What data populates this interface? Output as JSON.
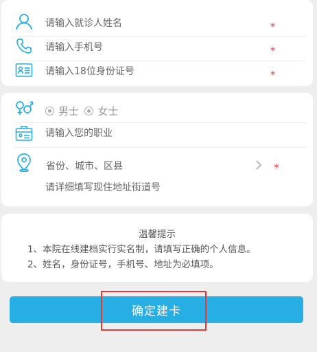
{
  "patient": {
    "name_placeholder": "请输入就诊人姓名",
    "phone_placeholder": "请输入手机号",
    "idcard_placeholder": "请输入18位身份证号",
    "required_mark": "*"
  },
  "profile": {
    "gender_options": [
      "男士",
      "女士"
    ],
    "occupation_placeholder": "请输入您的职业",
    "region_placeholder": "省份、城市、区县",
    "address_placeholder": "请详细填写现住地址街道号",
    "required_mark": "*"
  },
  "tips": {
    "title": "温馨提示",
    "line1": "1、本院在线建档实行实名制，请填写正确的个人信息。",
    "line2": "2、姓名，身份证号，手机号、地址为必填项。"
  },
  "actions": {
    "submit_label": "确定建卡"
  },
  "colors": {
    "accent": "#27aee3",
    "required": "#e8414a",
    "highlight_box": "#e53935"
  },
  "icons": [
    "person-icon",
    "phone-icon",
    "id-card-icon",
    "gender-icon",
    "briefcase-icon",
    "location-pin-icon",
    "chevron-right-icon"
  ]
}
